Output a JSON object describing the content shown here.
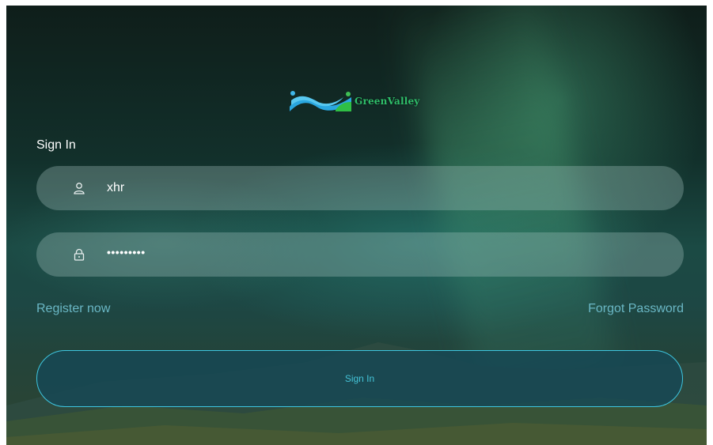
{
  "logo": {
    "text": "GreenValley",
    "icon": "greenvalley-wave-logo"
  },
  "form": {
    "title": "Sign In",
    "username": {
      "value": "xhr",
      "icon": "user-icon"
    },
    "password": {
      "masked_value": "•••••••••",
      "icon": "lock-icon"
    },
    "register_link": "Register now",
    "forgot_link": "Forgot Password",
    "submit_label": "Sign In"
  },
  "colors": {
    "link": "#6ab7c5",
    "button_border": "#3ec6e0",
    "button_text": "#44c2d6",
    "logo_text": "#2fbf6a"
  }
}
